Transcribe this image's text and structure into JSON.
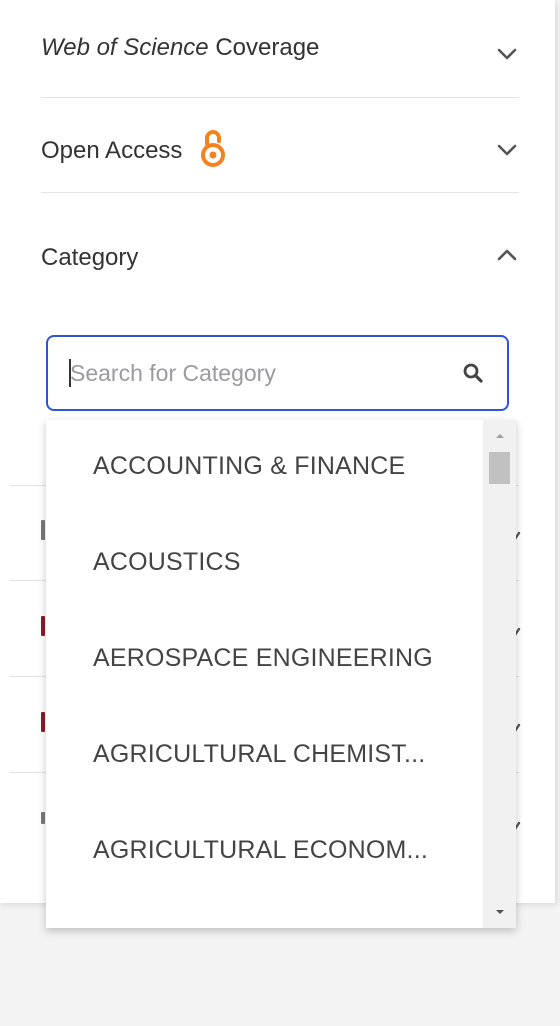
{
  "filters": {
    "wos_coverage": {
      "title_italic": "Web of Science",
      "title_rest": " Coverage"
    },
    "open_access": {
      "title": "Open Access",
      "icon": "open-access-icon",
      "icon_color": "#f5821f"
    },
    "category": {
      "title": "Category"
    }
  },
  "search": {
    "placeholder": "Search for Category",
    "value": ""
  },
  "dropdown": {
    "options": [
      "ACCOUNTING & FINANCE",
      "ACOUSTICS",
      "AEROSPACE ENGINEERING",
      "AGRICULTURAL CHEMIST...",
      "AGRICULTURAL ECONOM..."
    ]
  },
  "colors": {
    "focus_border": "#2f55d4",
    "text": "#333333",
    "muted": "#9a9aa0"
  }
}
